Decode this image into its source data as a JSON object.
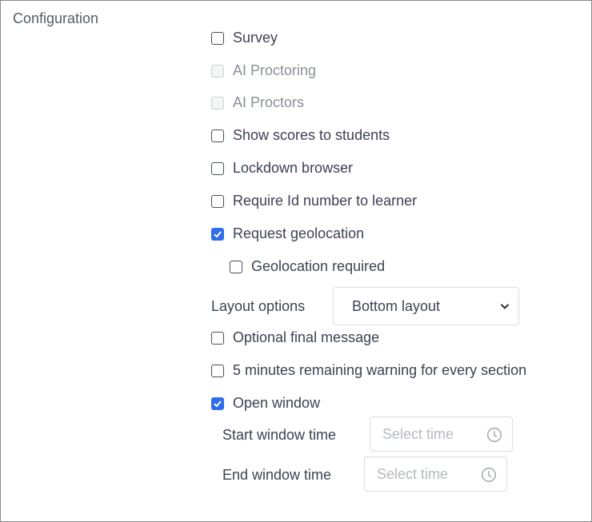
{
  "section": {
    "title": "Configuration"
  },
  "options": {
    "survey": {
      "label": "Survey",
      "checked": false
    },
    "ai_proctoring": {
      "label": "AI Proctoring",
      "checked": false,
      "disabled": true
    },
    "ai_proctors": {
      "label": "AI Proctors",
      "checked": false,
      "disabled": true
    },
    "show_scores": {
      "label": "Show scores to students",
      "checked": false
    },
    "lockdown_browser": {
      "label": "Lockdown browser",
      "checked": false
    },
    "require_id": {
      "label": "Require Id number to learner",
      "checked": false
    },
    "request_geolocation": {
      "label": "Request geolocation",
      "checked": true
    },
    "geolocation_required": {
      "label": "Geolocation required",
      "checked": false
    },
    "optional_final_message": {
      "label": "Optional final message",
      "checked": false
    },
    "five_min_warning": {
      "label": "5 minutes remaining warning for every section",
      "checked": false
    },
    "open_window": {
      "label": "Open window",
      "checked": true
    }
  },
  "layout_options": {
    "label": "Layout options",
    "selected": "Bottom layout"
  },
  "window_times": {
    "start": {
      "label": "Start window time",
      "placeholder": "Select time"
    },
    "end": {
      "label": "End window time",
      "placeholder": "Select time"
    }
  },
  "colors": {
    "accent": "#2f6ee8",
    "border": "#d9dce1"
  }
}
